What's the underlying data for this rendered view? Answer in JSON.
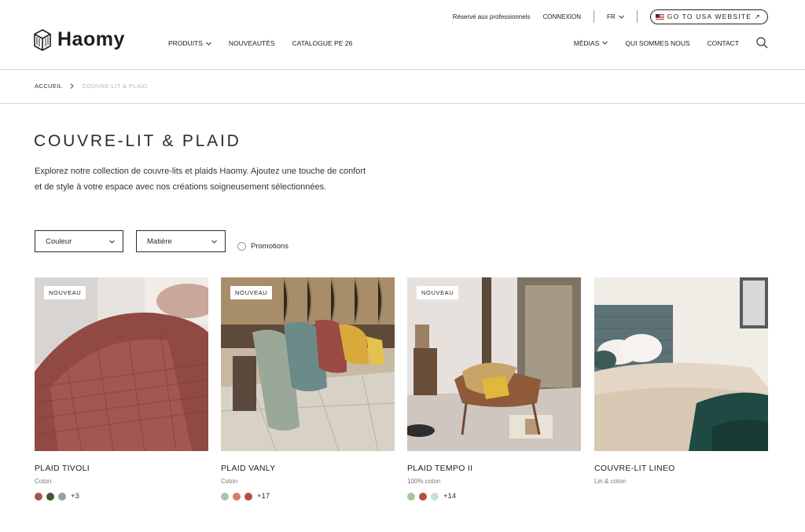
{
  "topbar": {
    "pro_label": "Réservé aux professionnels",
    "login_label": "CONNEXION",
    "language": "FR",
    "usa_label": "GO TO USA WEBSITE ↗"
  },
  "brand": {
    "name": "Haomy"
  },
  "nav": {
    "left": [
      "PRODUITS",
      "NOUVEAUTÉS",
      "CATALOGUE PE 26"
    ],
    "right": [
      "MÉDIAS",
      "QUI SOMMES NOUS",
      "CONTACT"
    ]
  },
  "breadcrumb": {
    "home": "ACCUEIL",
    "current": "COUVRE-LIT & PLAID"
  },
  "page": {
    "title": "COUVRE-LIT & PLAID",
    "intro_line1": "Explorez notre collection de couvre-lits et plaids Haomy. Ajoutez une touche de confort",
    "intro_line2": "et de style à votre espace avec nos créations soigneusement sélectionnées."
  },
  "filters": {
    "color": "Couleur",
    "material": "Matière",
    "promotions": "Promotions"
  },
  "products": [
    {
      "badge": "NOUVEAU",
      "name": "PLAID TIVOLI",
      "material": "Coton",
      "swatches": [
        "#a9554c",
        "#4a5236",
        "#8aa79c"
      ],
      "more": "+3"
    },
    {
      "badge": "NOUVEAU",
      "name": "PLAID VANLY",
      "material": "Coton",
      "swatches": [
        "#a7c6a4",
        "#d77a66",
        "#b44c45"
      ],
      "more": "+17"
    },
    {
      "badge": "NOUVEAU",
      "name": "PLAID TEMPO II",
      "material": "100% coton",
      "swatches": [
        "#a4c89c",
        "#b54f42",
        "#c9e0e2"
      ],
      "more": "+14"
    },
    {
      "badge": "",
      "name": "COUVRE-LIT LINEO",
      "material": "Lin & coton",
      "swatches": [],
      "more": ""
    }
  ]
}
